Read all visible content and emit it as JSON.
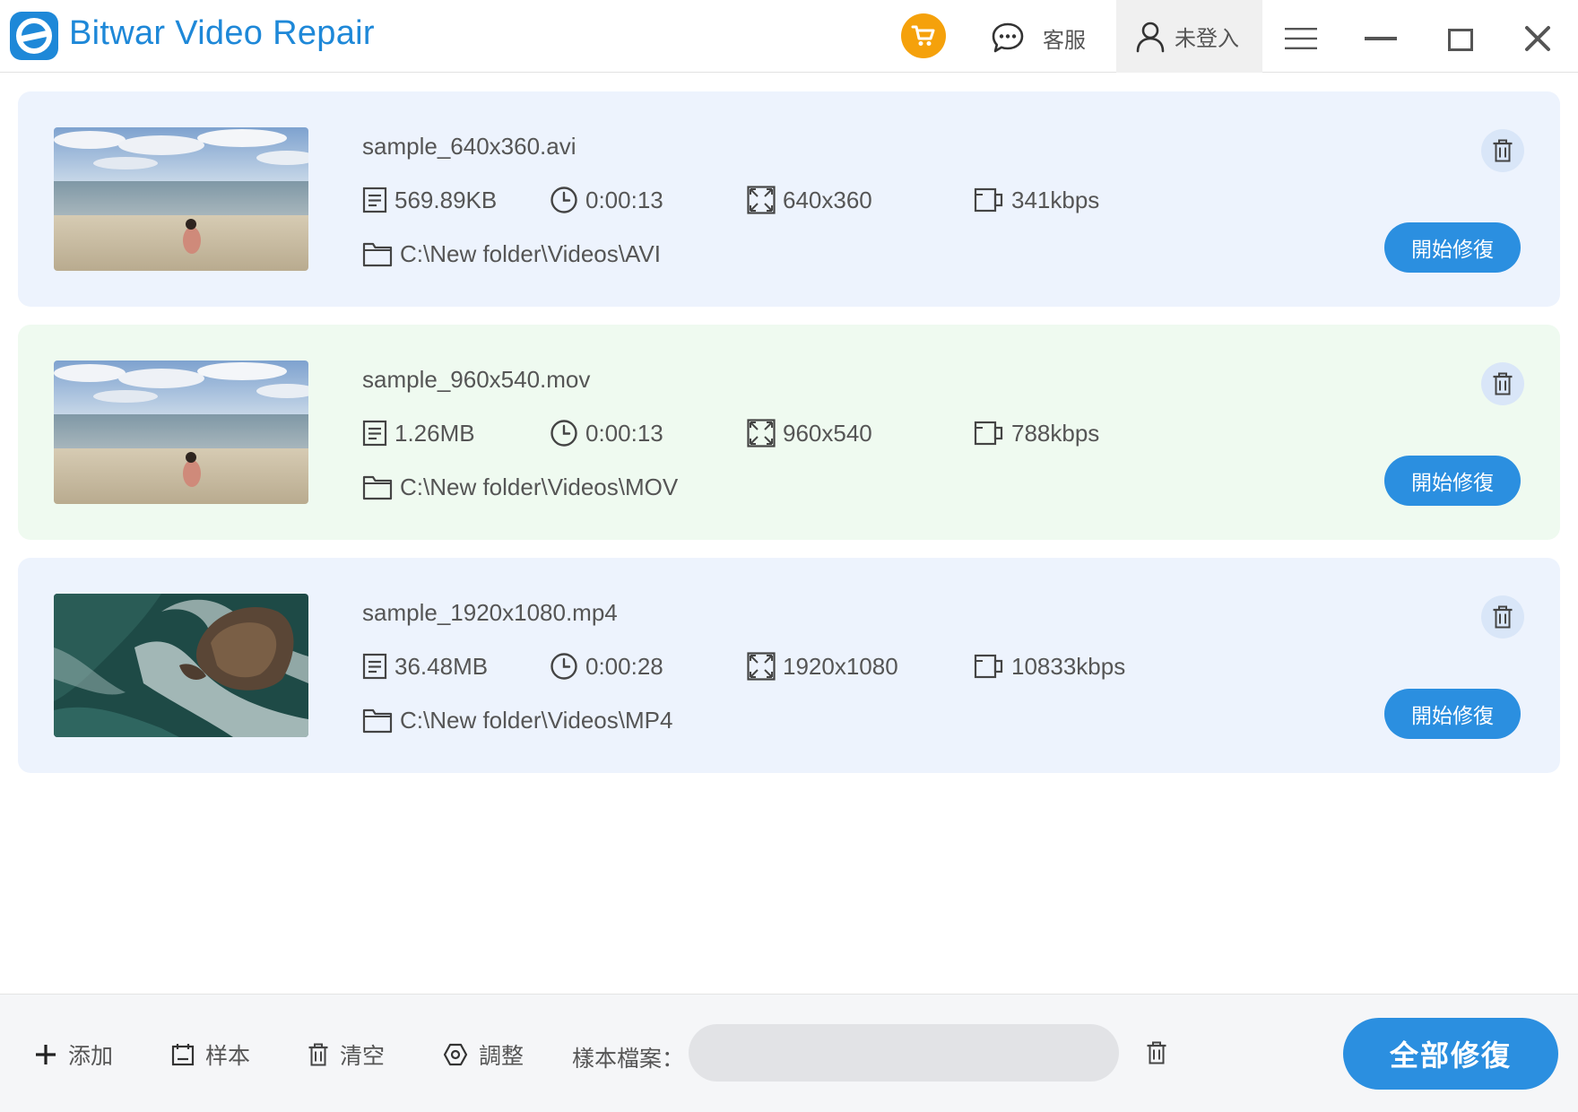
{
  "app": {
    "title": "Bitwar Video Repair",
    "brand_color": "#1e88d8",
    "accent_color": "#2b8fe0",
    "cart_color": "#f5a10b"
  },
  "header": {
    "support_label": "客服",
    "account_label": "未登入"
  },
  "videos": [
    {
      "filename": "sample_640x360.avi",
      "size": "569.89KB",
      "duration": "0:00:13",
      "resolution": "640x360",
      "bitrate": "341kbps",
      "path": "C:\\New folder\\Videos\\AVI",
      "repair_label": "開始修復",
      "thumbnail": "beach-thumbnail"
    },
    {
      "filename": "sample_960x540.mov",
      "size": "1.26MB",
      "duration": "0:00:13",
      "resolution": "960x540",
      "bitrate": "788kbps",
      "path": "C:\\New folder\\Videos\\MOV",
      "repair_label": "開始修復",
      "thumbnail": "beach-thumbnail"
    },
    {
      "filename": "sample_1920x1080.mp4",
      "size": "36.48MB",
      "duration": "0:00:28",
      "resolution": "1920x1080",
      "bitrate": "10833kbps",
      "path": "C:\\New folder\\Videos\\MP4",
      "repair_label": "開始修復",
      "thumbnail": "ocean-rock-thumbnail"
    }
  ],
  "toolbar": {
    "add_label": "添加",
    "sample_label": "样本",
    "clear_label": "清空",
    "adjust_label": "調整",
    "sample_file_label": "樣本檔案：",
    "sample_file_value": "",
    "repair_all_label": "全部修復"
  }
}
